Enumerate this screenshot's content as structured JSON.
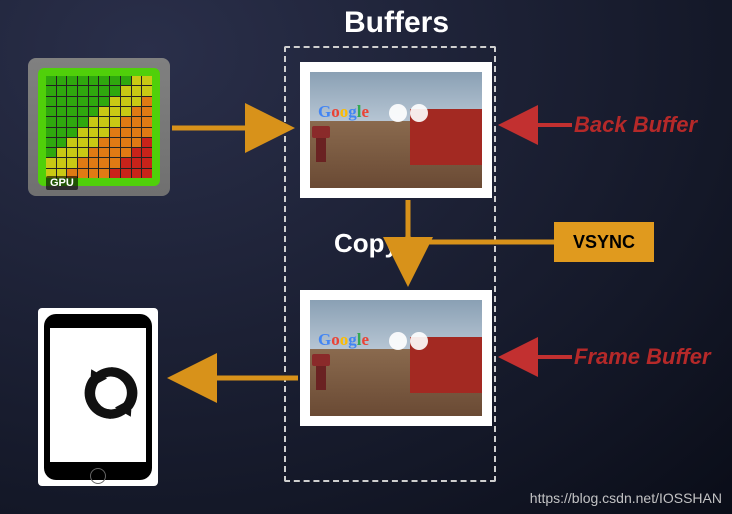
{
  "title": "Buffers",
  "gpu": {
    "label": "GPU"
  },
  "labels": {
    "back_buffer": "Back Buffer",
    "frame_buffer": "Frame Buffer",
    "copy": "Copy",
    "vsync": "VSYNC"
  },
  "watermark": "https://blog.csdn.net/IOSSHAN",
  "scene_logo": {
    "g": "G",
    "o1": "o",
    "o2": "o",
    "gl": "g",
    "l": "l",
    "e": "e"
  },
  "colors": {
    "arrow": "#d8921a",
    "arrow_red": "#c23030",
    "vsync_bg": "#e09a1e",
    "red_label": "#b52929"
  }
}
